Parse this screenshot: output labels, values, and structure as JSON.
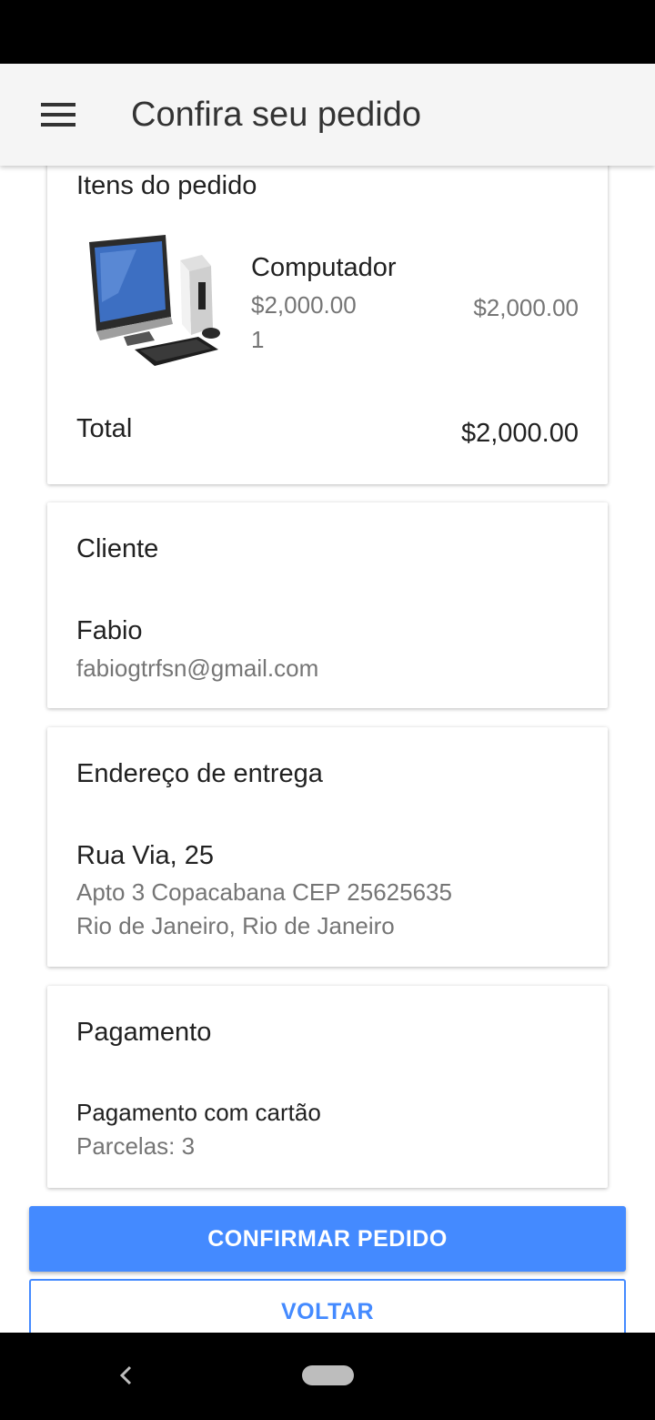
{
  "app_bar": {
    "title": "Confira seu pedido",
    "menu_icon": "hamburger-menu-icon"
  },
  "order_items": {
    "title": "Itens do pedido",
    "items": [
      {
        "name": "Computador",
        "unit_price": "$2,000.00",
        "quantity": "1",
        "subtotal": "$2,000.00",
        "image": "desktop-computer-image"
      }
    ],
    "total_label": "Total",
    "total_value": "$2,000.00"
  },
  "client": {
    "title": "Cliente",
    "name": "Fabio",
    "email": "fabiogtrfsn@gmail.com"
  },
  "address": {
    "title": "Endereço de entrega",
    "street": "Rua Via, 25",
    "line2": "Apto 3 Copacabana CEP 25625635",
    "line3": "Rio de Janeiro, Rio de Janeiro"
  },
  "payment": {
    "title": "Pagamento",
    "method": "Pagamento com cartão",
    "installments": "Parcelas: 3"
  },
  "actions": {
    "confirm": "CONFIRMAR PEDIDO",
    "back": "VOLTAR"
  },
  "colors": {
    "accent": "#448aff",
    "app_bar_bg": "#f5f5f5",
    "text_primary": "#212121",
    "text_secondary": "#757575"
  }
}
